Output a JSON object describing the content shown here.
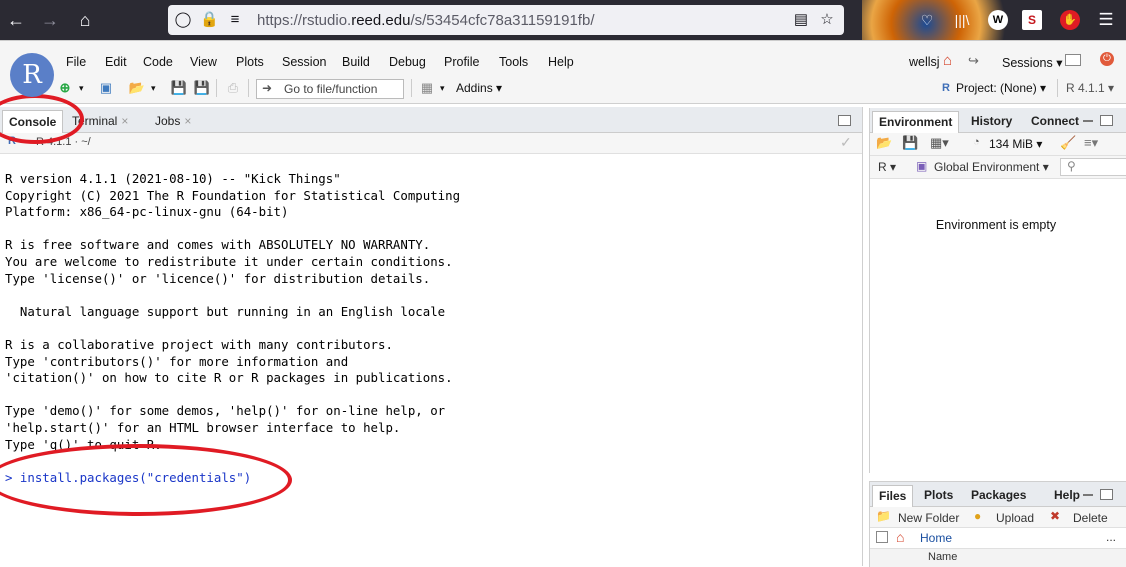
{
  "browser": {
    "url_prefix": "https://rstudio.",
    "url_domain": "reed.edu",
    "url_path": "/s/53454cfc78a31159191fb/",
    "back_icon": "arrow-left-icon",
    "forward_icon": "arrow-right-icon",
    "home_icon": "home-icon",
    "ext_w": "W",
    "ext_s": "S"
  },
  "menu": {
    "items": [
      "File",
      "Edit",
      "Code",
      "View",
      "Plots",
      "Session",
      "Build",
      "Debug",
      "Profile",
      "Tools",
      "Help"
    ],
    "user": "wellsj",
    "sessions_label": "Sessions",
    "logo_letter": "R"
  },
  "toolbar": {
    "goto_placeholder": "Go to file/function",
    "addins_label": "Addins",
    "project_label": "Project: (None)",
    "r_version": "R 4.1.1"
  },
  "console": {
    "tabs": [
      {
        "label": "Console"
      },
      {
        "label": "Terminal"
      },
      {
        "label": "Jobs"
      }
    ],
    "tab_close": "×",
    "path_label": "R 4.1.1 · ~/",
    "output": "R version 4.1.1 (2021-08-10) -- \"Kick Things\"\nCopyright (C) 2021 The R Foundation for Statistical Computing\nPlatform: x86_64-pc-linux-gnu (64-bit)\n\nR is free software and comes with ABSOLUTELY NO WARRANTY.\nYou are welcome to redistribute it under certain conditions.\nType 'license()' or 'licence()' for distribution details.\n\n  Natural language support but running in an English locale\n\nR is a collaborative project with many contributors.\nType 'contributors()' for more information and\n'citation()' on how to cite R or R packages in publications.\n\nType 'demo()' for some demos, 'help()' for on-line help, or\n'help.start()' for an HTML browser interface to help.\nType 'q()' to quit R.",
    "prompt": "> install.packages(\"credentials\")"
  },
  "environment": {
    "tabs": [
      "Environment",
      "History",
      "Connect"
    ],
    "memory": "134 MiB",
    "language": "R",
    "scope": "Global Environment",
    "empty_message": "Environment is empty"
  },
  "files": {
    "tabs": [
      "Files",
      "Plots",
      "Packages",
      "Help"
    ],
    "new_folder": "New Folder",
    "upload": "Upload",
    "delete": "Delete",
    "path_home": "Home",
    "col_name": "Name",
    "more": "..."
  },
  "colors": {
    "annotation_red": "#e01b24",
    "r_blue": "#5a7fc8",
    "prompt_blue": "#1a36c8"
  }
}
